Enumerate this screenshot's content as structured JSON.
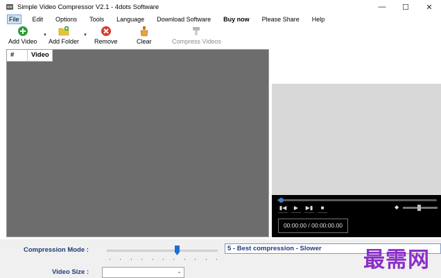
{
  "window": {
    "title": "Simple Video Compressor V2.1 - 4dots Software"
  },
  "menu": [
    {
      "label": "File"
    },
    {
      "label": "Edit"
    },
    {
      "label": "Options"
    },
    {
      "label": "Tools"
    },
    {
      "label": "Language"
    },
    {
      "label": "Download Software"
    },
    {
      "label": "Buy now"
    },
    {
      "label": "Please Share"
    },
    {
      "label": "Help"
    }
  ],
  "toolbar": {
    "add_video": "Add Video",
    "add_folder": "Add Folder",
    "remove": "Remove",
    "clear": "Clear",
    "compress_videos": "Compress Videos"
  },
  "list": {
    "columns": [
      "#",
      "Video"
    ]
  },
  "player": {
    "time": "00:00:00 / 00:00:00.00"
  },
  "settings": {
    "compression_mode_label": "Compression Mode :",
    "compression_value": "5 - Best compression - Slower",
    "video_size_label": "Video Size :",
    "colon": ":"
  },
  "watermark": "最需网",
  "colors": {
    "accent": "#1f3a7a",
    "slider": "#1e6fd0",
    "list_bg": "#6d6d6d",
    "watermark": "#8b2fc9"
  }
}
